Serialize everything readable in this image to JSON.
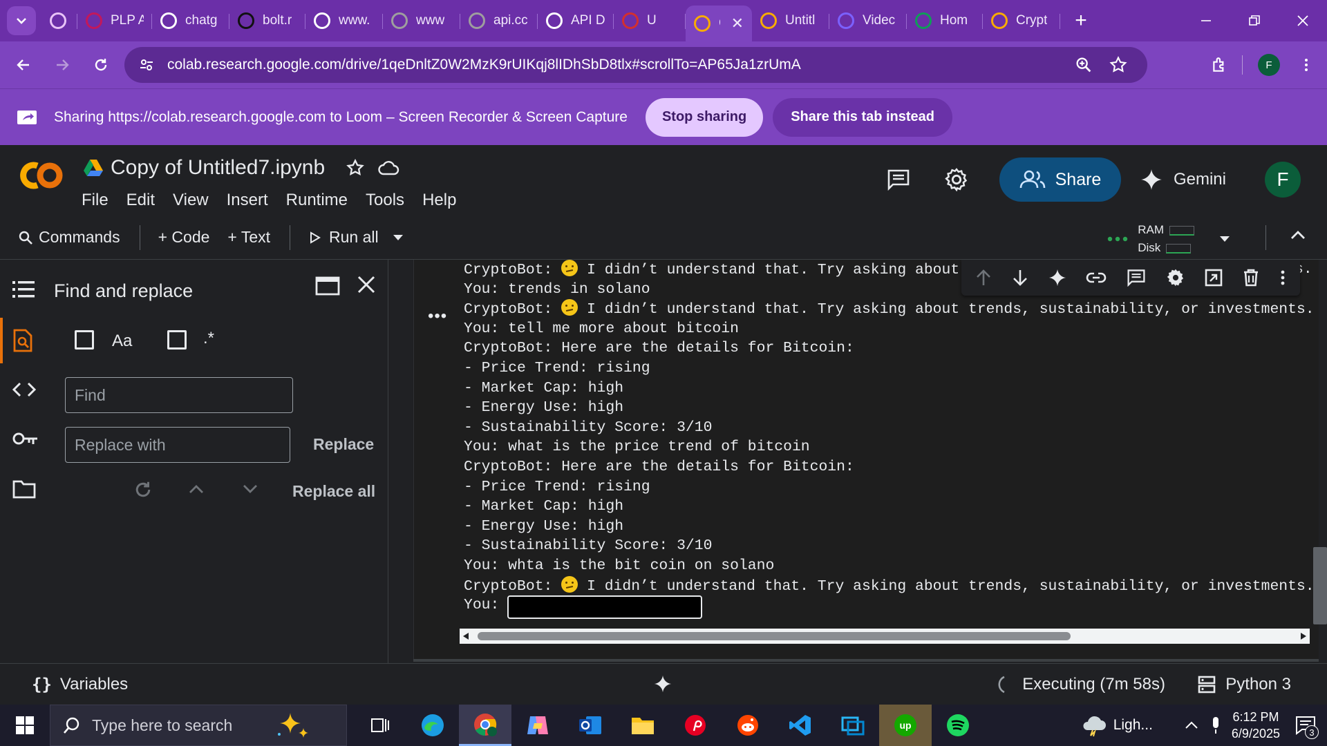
{
  "browser": {
    "tabs": [
      {
        "title": "",
        "favicon_color": "#e8c3f7"
      },
      {
        "title": "PLP A",
        "favicon_color": "#c2185b"
      },
      {
        "title": "chatg",
        "favicon_color": "#ffffff"
      },
      {
        "title": "bolt.r",
        "favicon_color": "#111111"
      },
      {
        "title": "www.",
        "favicon_color": "#ffffff"
      },
      {
        "title": "www",
        "favicon_color": "#9e9e9e"
      },
      {
        "title": "api.cc",
        "favicon_color": "#9e9e9e"
      },
      {
        "title": "API D",
        "favicon_color": "#ffffff"
      },
      {
        "title": "U",
        "favicon_color": "#d32f2f"
      },
      {
        "title": "C",
        "favicon_color": "#f9ab00",
        "active": true
      },
      {
        "title": "Untitl",
        "favicon_color": "#f9ab00"
      },
      {
        "title": "Videc",
        "favicon_color": "#7b61ff"
      },
      {
        "title": "Hom",
        "favicon_color": "#0f9d58"
      },
      {
        "title": "Crypt",
        "favicon_color": "#f9ab00"
      }
    ],
    "url": "colab.research.google.com/drive/1qeDnltZ0W2MzK9rUIKqj8lIDhSbD8tlx#scrollTo=AP65Ja1zrUmA",
    "profile_initial": "F"
  },
  "sharing": {
    "message": "Sharing https://colab.research.google.com to Loom – Screen Recorder & Screen Capture",
    "stop_label": "Stop sharing",
    "share_tab_label": "Share this tab instead"
  },
  "colab": {
    "title": "Copy of Untitled7.ipynb",
    "menu": [
      "File",
      "Edit",
      "View",
      "Insert",
      "Runtime",
      "Tools",
      "Help"
    ],
    "share_label": "Share",
    "gemini_label": "Gemini",
    "avatar_initial": "F",
    "toolbar": {
      "commands": "Commands",
      "code": "+ Code",
      "text": "+ Text",
      "run_all": "Run all",
      "ram": "RAM",
      "disk": "Disk"
    }
  },
  "find_panel": {
    "title": "Find and replace",
    "match_case": "Aa",
    "regex": ".*",
    "find_placeholder": "Find",
    "replace_placeholder": "Replace with",
    "replace": "Replace",
    "replace_all": "Replace all"
  },
  "output": {
    "lines": [
      {
        "text": "CryptoBot: ",
        "emoji": true,
        "rest": " I didn’t understand that. Try asking about",
        "tail": "s."
      },
      {
        "text": "You: trends in solano"
      },
      {
        "text": "CryptoBot: ",
        "emoji": true,
        "rest": " I didn’t understand that. Try asking about trends, sustainability, or investments."
      },
      {
        "text": "You: tell me more about bitcoin"
      },
      {
        "text": "CryptoBot: Here are the details for Bitcoin:"
      },
      {
        "text": "- Price Trend: rising"
      },
      {
        "text": "- Market Cap: high"
      },
      {
        "text": "- Energy Use: high"
      },
      {
        "text": "- Sustainability Score: 3/10"
      },
      {
        "text": "You: what is the price trend of bitcoin"
      },
      {
        "text": "CryptoBot: Here are the details for Bitcoin:"
      },
      {
        "text": "- Price Trend: rising"
      },
      {
        "text": "- Market Cap: high"
      },
      {
        "text": "- Energy Use: high"
      },
      {
        "text": "- Sustainability Score: 3/10"
      },
      {
        "text": "You: whta is the bit coin on solano"
      },
      {
        "text": "CryptoBot: ",
        "emoji": true,
        "rest": " I didn’t understand that. Try asking about trends, sustainability, or investments."
      },
      {
        "text": "You: "
      }
    ]
  },
  "status": {
    "variables": "Variables",
    "executing": "Executing (7m 58s)",
    "runtime": "Python 3"
  },
  "taskbar": {
    "search_placeholder": "Type here to search",
    "weather": "Ligh...",
    "time": "6:12 PM",
    "date": "6/9/2025",
    "notifications": "3"
  }
}
